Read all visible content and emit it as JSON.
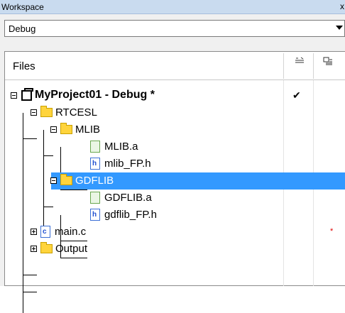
{
  "window": {
    "title": "Workspace",
    "close_glyph": "x"
  },
  "config_dropdown": {
    "selected": "Debug"
  },
  "header": {
    "files_label": "Files",
    "col1_icon": "check-column-icon",
    "col2_icon": "options-column-icon"
  },
  "tree": {
    "project": {
      "label": "MyProject01 - Debug *",
      "check": "✔"
    },
    "rtcesl": {
      "label": "RTCESL"
    },
    "mlib": {
      "label": "MLIB"
    },
    "mlib_a": {
      "label": "MLIB.a",
      "glyph": ""
    },
    "mlib_fp": {
      "label": "mlib_FP.h",
      "glyph": "h"
    },
    "gdflib": {
      "label": "GDFLIB"
    },
    "gdflib_a": {
      "label": "GDFLIB.a",
      "glyph": ""
    },
    "gdflib_fp": {
      "label": "gdflib_FP.h",
      "glyph": "h"
    },
    "main_c": {
      "label": "main.c",
      "glyph": "c",
      "mark": "*"
    },
    "output": {
      "label": "Output"
    }
  },
  "colors": {
    "selection": "#3399ff",
    "title_bar": "#c9dbef",
    "folder": "#ffd43c",
    "modified_mark": "#e00000"
  }
}
